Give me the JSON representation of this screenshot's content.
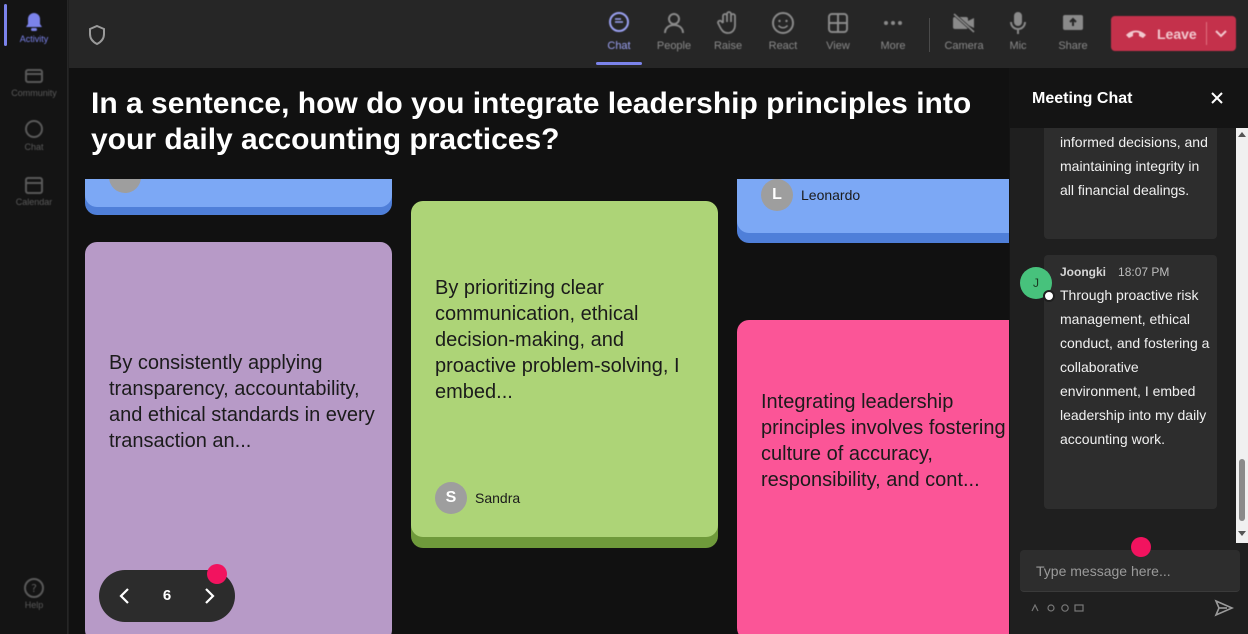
{
  "rail": {
    "items": [
      {
        "label": "Activity"
      },
      {
        "label": "Community"
      },
      {
        "label": "Chat"
      },
      {
        "label": "Calendar"
      },
      {
        "label": "Help"
      }
    ]
  },
  "toolbar": {
    "chat": "Chat",
    "people": "People",
    "raise": "Raise",
    "react": "React",
    "view": "View",
    "more": "More",
    "camera": "Camera",
    "mic": "Mic",
    "share": "Share",
    "leave": "Leave"
  },
  "question": "In a sentence, how do you integrate leadership principles into your daily accounting practices?",
  "cards": {
    "purple_text": "By consistently applying transparency, accountability, and ethical standards in every transaction an...",
    "green_text": "By prioritizing clear communication, ethical decision-making, and proactive problem-solving, I embed...",
    "green_author_initial": "S",
    "green_author": "Sandra",
    "blue_author_initial": "L",
    "blue_author": "Leonardo",
    "pink_text": "Integrating leadership principles involves fostering a culture of accuracy, responsibility, and cont..."
  },
  "pager": {
    "page": "6"
  },
  "chat": {
    "title": "Meeting Chat",
    "messages": [
      {
        "text": "informed decisions, and maintaining integrity in all financial dealings."
      },
      {
        "avatar": "J",
        "sender": "Joongki",
        "time": "18:07 PM",
        "text": "Through proactive risk management, ethical conduct, and fostering a collaborative environment, I embed leadership into my daily accounting work."
      }
    ],
    "input_placeholder": "Type message here..."
  },
  "colors": {
    "accent": "#7b83eb",
    "leave": "#c4314b",
    "card_purple": "#b79ac7",
    "card_green": "#add477",
    "card_blue": "#7ca8f5",
    "card_pink": "#fb5597",
    "notification_dot": "#f2135f"
  }
}
